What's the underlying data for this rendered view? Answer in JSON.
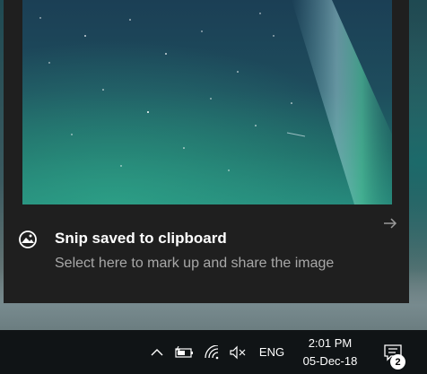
{
  "notification": {
    "title": "Snip saved to clipboard",
    "body": "Select here to mark up and share the image",
    "app_icon": "snip-sketch-icon",
    "dismiss_icon": "arrow-right-icon",
    "preview": "night sky aurora snip thumbnail"
  },
  "taskbar": {
    "overflow_icon": "chevron-up-icon",
    "battery_icon": "battery-charging-icon",
    "network_icon": "wifi-icon",
    "volume_icon": "volume-muted-icon",
    "language": "ENG",
    "time": "2:01 PM",
    "date": "05-Dec-18",
    "action_center_icon": "action-center-icon",
    "notification_count": "2"
  },
  "colors": {
    "toast_background": "#1f1f1f",
    "taskbar_background": "#101416",
    "title_text": "#ffffff",
    "body_text": "#a8a8a8"
  }
}
